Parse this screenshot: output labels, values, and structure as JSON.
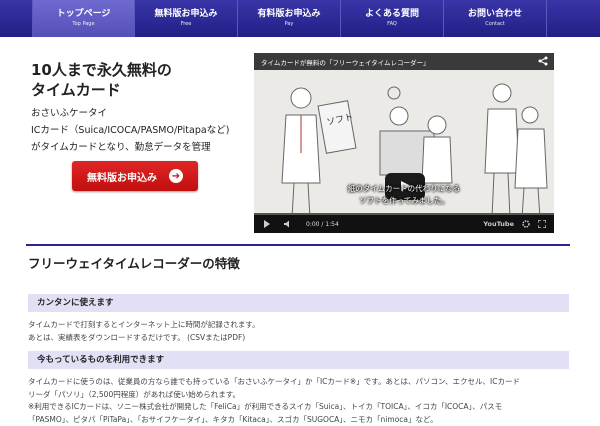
{
  "nav": [
    {
      "main": "トップページ",
      "sub": "Top Page"
    },
    {
      "main": "無料版お申込み",
      "sub": "Free"
    },
    {
      "main": "有料版お申込み",
      "sub": "Pay"
    },
    {
      "main": "よくある質問",
      "sub": "FAQ"
    },
    {
      "main": "お問い合わせ",
      "sub": "Contact"
    }
  ],
  "hero": {
    "title_line1": "10人まで永久無料の",
    "title_line2": "タイムカード",
    "desc_line1": "おさいふケータイ",
    "desc_line2": "ICカード（Suica/ICOCA/PASMO/Pitapaなど)",
    "desc_line3": "がタイムカードとなり、勤怠データを管理",
    "cta_label": "無料版お申込み",
    "cta_arrow": "➔"
  },
  "video": {
    "title": "タイムカードが無料の「フリーウェイタイムレコーダー」",
    "sign_text": "ソフト",
    "caption_line1": "紙のタイムカードの代わりになる",
    "caption_line2": "ソフトを作ってみました。",
    "time": "0:00 / 1:54",
    "brand": "YouTube",
    "icons": [
      "share-icon",
      "play-icon",
      "volume-icon",
      "gear-icon",
      "fullscreen-icon"
    ]
  },
  "features": {
    "title": "フリーウェイタイムレコーダーの特徴",
    "items": [
      {
        "heading": "カンタンに使えます",
        "lines": [
          "タイムカードで打刻するとインターネット上に時間が記録されます。",
          "あとは、実績表をダウンロードするだけです。 (CSVまたはPDF)"
        ]
      },
      {
        "heading": "今もっているものを利用できます",
        "lines": [
          "タイムカードに使うのは、従業員の方なら誰でも持っている「おさいふケータイ」か「ICカード※」です。あとは、パソコン、エクセル、ICカード",
          "リーダ「パソリ」（2,500円程度）があれば使い始められます。",
          "※利用できるICカードは、ソニー株式会社が開発した「FeliCa」が利用できるスイカ「Suica」、トイカ「TOICA」、イコカ「ICOCA」、パスモ",
          "「PASMO」、ピタパ「PiTaPa」、「おサイフケータイ」、キタカ「Kitaca」、スゴカ「SUGOCA」、ニモカ「nimoca」など。"
        ]
      }
    ]
  },
  "colors": {
    "nav": "#2a2690",
    "cta": "#d41b1b",
    "feature_band": "#e1e0f5"
  }
}
